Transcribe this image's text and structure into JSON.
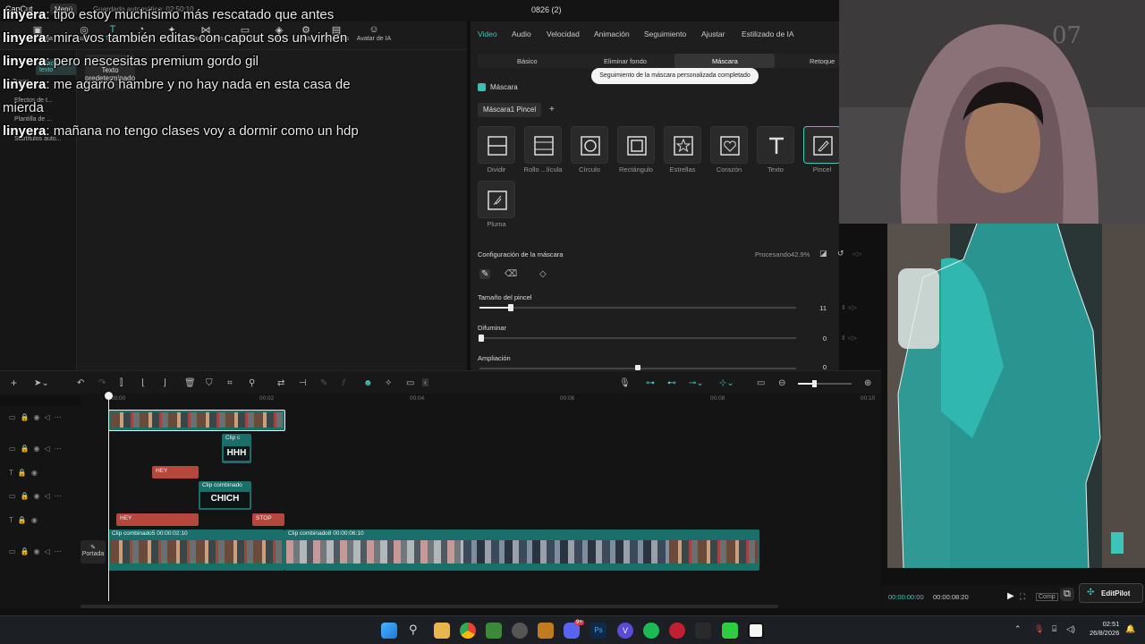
{
  "app": {
    "logo": "CapCut",
    "menu_label": "Menú",
    "autosave": "Guardado automático: 02:50:10",
    "project_title": "0826 (2)"
  },
  "toolstrip": [
    {
      "label": "Multimedia",
      "icon": "media-icon"
    },
    {
      "label": "Audio",
      "icon": "audio-icon"
    },
    {
      "label": "Texto",
      "icon": "text-icon"
    },
    {
      "label": "Stickers",
      "icon": "sticker-icon"
    },
    {
      "label": "Efectos",
      "icon": "effects-icon"
    },
    {
      "label": "Transiciones",
      "icon": "transition-icon"
    },
    {
      "label": "Subtítulos",
      "icon": "subtitle-icon"
    },
    {
      "label": "Filtros",
      "icon": "filter-icon"
    },
    {
      "label": "Ajustes",
      "icon": "adjust-icon"
    },
    {
      "label": "Plantillas",
      "icon": "template-icon"
    },
    {
      "label": "Avatar de IA",
      "icon": "avatar-icon"
    }
  ],
  "sidebar": {
    "items": [
      "Añadir texto",
      "Tuyos",
      "Efectos de t...",
      "Plantilla de ...",
      "Subtítulos auto..."
    ]
  },
  "text_card": "Texto predeterminado",
  "chat": [
    {
      "user": "linyera",
      "text": ": tipo estoy muchísimo más rescatado que antes"
    },
    {
      "user": "linyera",
      "text": ": mira vos también editas con capcut sos un virhen"
    },
    {
      "user": "linyera",
      "text": ": pero nescesitas premium gordo gil"
    },
    {
      "user": "linyera",
      "text": ": me agarró hambre y no hay nada en esta casa de mierda"
    },
    {
      "user": "linyera",
      "text": ": mañana no tengo clases voy a dormir como un hdp"
    }
  ],
  "inspector": {
    "tabs": [
      "Video",
      "Audio",
      "Velocidad",
      "Animación",
      "Seguimiento",
      "Ajustar",
      "Estilizado de IA"
    ],
    "active_tab": "Video",
    "subtabs": [
      "Básico",
      "Eliminar fondo",
      "Máscara",
      "Retoque"
    ],
    "active_subtab": "Máscara",
    "toast": "Seguimiento de la máscara personalizada completado",
    "mask_label": "Máscara",
    "mask_pill": "Máscara1 Pincel",
    "mask_types": [
      "Dividir",
      "Rollo ...lícula",
      "Círculo",
      "Rectángulo",
      "Estrellas",
      "Corazón",
      "Texto",
      "Pincel",
      "Pluma"
    ],
    "selected_mask": "Pincel",
    "config_title": "Configuración de la máscara",
    "processing": "Procesando42.9%",
    "brush_size_label": "Tamaño del pincel",
    "brush_size_value": "11",
    "brush_size_fraction": 0.1,
    "feather_label": "Difuminar",
    "feather_value": "0",
    "expand_label": "Ampliación",
    "expand_value": "0",
    "expand_fraction": 0.5
  },
  "timeline": {
    "ruler": [
      "00:00",
      "00:02",
      "00:04",
      "00:06",
      "00:08",
      "00:10"
    ],
    "clips": {
      "overlay_small": "Clip c",
      "overlay_combined": "Clip combinado",
      "text_hey_1": "HEY",
      "text_hey_2": "HEY",
      "text_stop": "STOP",
      "main_1": "Clip combinado5   00:00:02:10",
      "main_2": "Clip combinado8   00:00:06:10",
      "caption_hhh": "HHH",
      "caption_chich": "CHICH"
    },
    "cover_label": "Portada"
  },
  "preview": {
    "current_time": "00:00:00:00",
    "total_time": "00:00:08:20",
    "compare_label": "Comp",
    "editpilot": "EditPilot"
  },
  "taskbar": {
    "time": "02:51",
    "date": "26/8/2026",
    "badge": "9+"
  },
  "colors": {
    "accent": "#41c5bd",
    "panel": "#1e1e1e",
    "text_clip": "#b5473d",
    "video_clip": "#1a6f6b"
  }
}
